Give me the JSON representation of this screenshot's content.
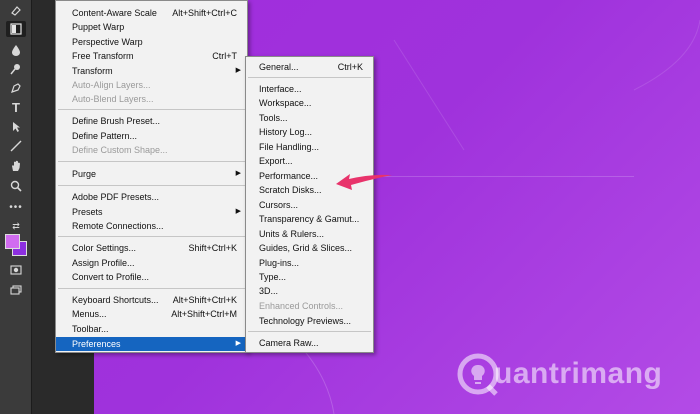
{
  "toolbar": {
    "tools": [
      "eraser-icon",
      "gradient-icon",
      "blur-icon",
      "dodge-icon",
      "pen-icon",
      "type-icon",
      "path-selection-icon",
      "line-icon",
      "hand-icon",
      "zoom-icon",
      "more-tools-icon",
      "swap-colors-icon",
      "quick-mask-icon",
      "screen-mode-icon"
    ],
    "foreground_color": "#d16cf0",
    "background_color": "#8d2fe0"
  },
  "edit_menu": {
    "items": [
      {
        "label": "Content-Aware Scale",
        "shortcut": "Alt+Shift+Ctrl+C"
      },
      {
        "label": "Puppet Warp",
        "shortcut": ""
      },
      {
        "label": "Perspective Warp",
        "shortcut": ""
      },
      {
        "label": "Free Transform",
        "shortcut": "Ctrl+T"
      },
      {
        "label": "Transform",
        "shortcut": ""
      },
      {
        "label": "Auto-Align Layers...",
        "shortcut": ""
      },
      {
        "label": "Auto-Blend Layers...",
        "shortcut": ""
      },
      {
        "label": "Define Brush Preset...",
        "shortcut": ""
      },
      {
        "label": "Define Pattern...",
        "shortcut": ""
      },
      {
        "label": "Define Custom Shape...",
        "shortcut": ""
      },
      {
        "label": "Purge",
        "shortcut": ""
      },
      {
        "label": "Adobe PDF Presets...",
        "shortcut": ""
      },
      {
        "label": "Presets",
        "shortcut": ""
      },
      {
        "label": "Remote Connections...",
        "shortcut": ""
      },
      {
        "label": "Color Settings...",
        "shortcut": "Shift+Ctrl+K"
      },
      {
        "label": "Assign Profile...",
        "shortcut": ""
      },
      {
        "label": "Convert to Profile...",
        "shortcut": ""
      },
      {
        "label": "Keyboard Shortcuts...",
        "shortcut": "Alt+Shift+Ctrl+K"
      },
      {
        "label": "Menus...",
        "shortcut": "Alt+Shift+Ctrl+M"
      },
      {
        "label": "Toolbar...",
        "shortcut": ""
      },
      {
        "label": "Preferences",
        "shortcut": ""
      }
    ]
  },
  "preferences_menu": {
    "items": [
      {
        "label": "General...",
        "shortcut": "Ctrl+K"
      },
      {
        "label": "Interface...",
        "shortcut": ""
      },
      {
        "label": "Workspace...",
        "shortcut": ""
      },
      {
        "label": "Tools...",
        "shortcut": ""
      },
      {
        "label": "History Log...",
        "shortcut": ""
      },
      {
        "label": "File Handling...",
        "shortcut": ""
      },
      {
        "label": "Export...",
        "shortcut": ""
      },
      {
        "label": "Performance...",
        "shortcut": ""
      },
      {
        "label": "Scratch Disks...",
        "shortcut": ""
      },
      {
        "label": "Cursors...",
        "shortcut": ""
      },
      {
        "label": "Transparency & Gamut...",
        "shortcut": ""
      },
      {
        "label": "Units & Rulers...",
        "shortcut": ""
      },
      {
        "label": "Guides, Grid & Slices...",
        "shortcut": ""
      },
      {
        "label": "Plug-ins...",
        "shortcut": ""
      },
      {
        "label": "Type...",
        "shortcut": ""
      },
      {
        "label": "3D...",
        "shortcut": ""
      },
      {
        "label": "Enhanced Controls...",
        "shortcut": ""
      },
      {
        "label": "Technology Previews...",
        "shortcut": ""
      },
      {
        "label": "Camera Raw...",
        "shortcut": ""
      }
    ]
  },
  "annotation": {
    "arrow_color": "#e8336b"
  },
  "watermark": {
    "text": "uantrimang"
  },
  "colors": {
    "highlight": "#1565c0",
    "canvas": "#a12ddd",
    "menu_bg": "#f2f2f2"
  }
}
